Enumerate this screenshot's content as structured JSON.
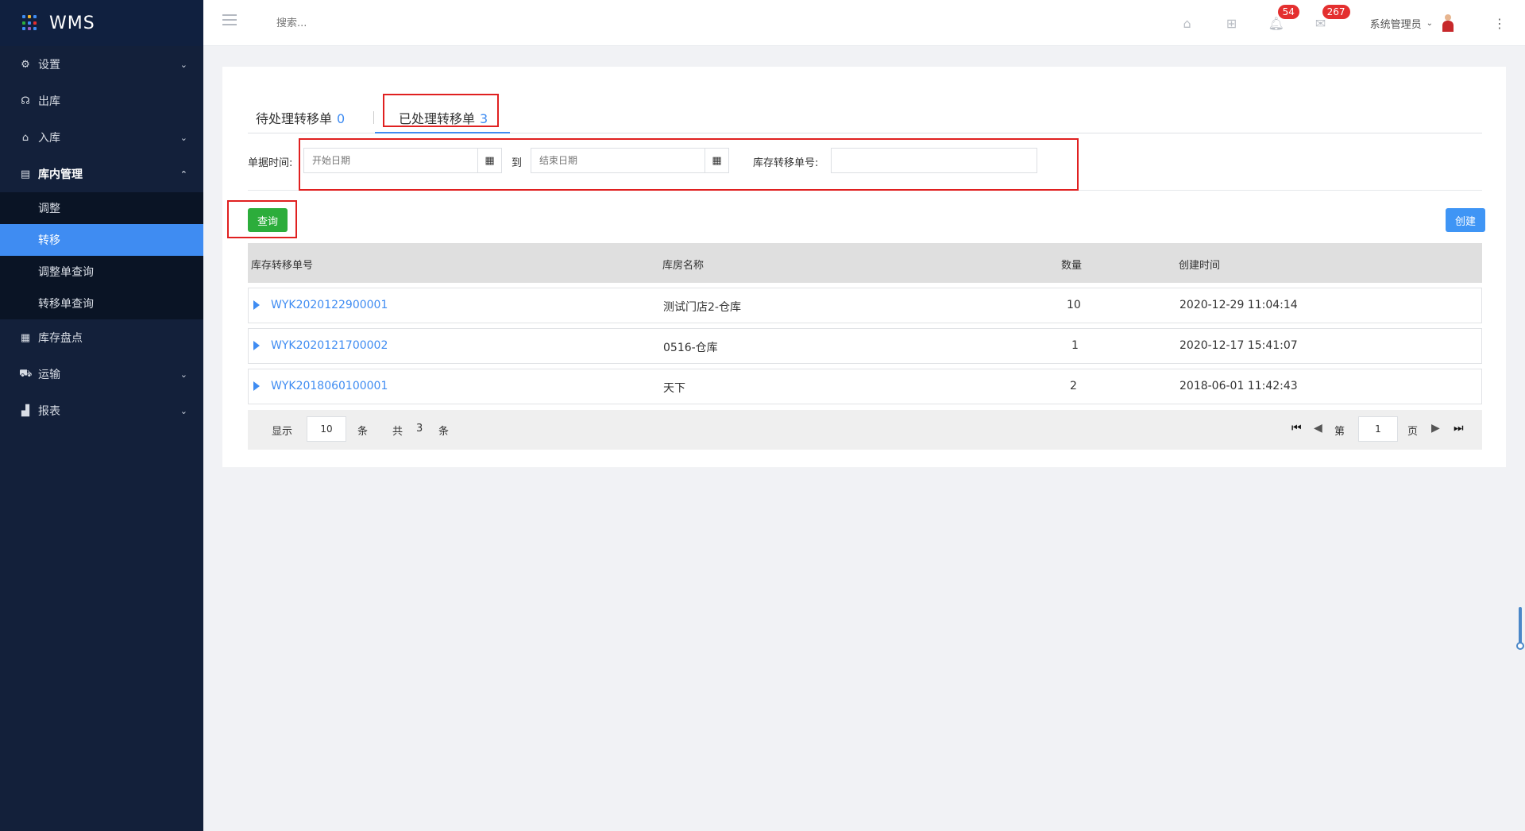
{
  "app": {
    "title": "WMS",
    "brand_dot_colors": [
      "#3f8cf2",
      "#f0b429",
      "#3f8cf2",
      "#2cad3b",
      "#3f8cf2",
      "#e42f2f",
      "#3f8cf2",
      "#9b59b6",
      "#3f8cf2"
    ]
  },
  "sidebar": {
    "items": [
      {
        "label": "设置",
        "icon": "gear-icon",
        "has_chevron": true
      },
      {
        "label": "出库",
        "icon": "headset-icon",
        "has_chevron": false
      },
      {
        "label": "入库",
        "icon": "home-icon",
        "has_chevron": true
      },
      {
        "label": "库内管理",
        "icon": "warehouse-icon",
        "has_chevron": true,
        "expanded": true
      },
      {
        "label": "库存盘点",
        "icon": "clipboard-icon",
        "has_chevron": false
      },
      {
        "label": "运输",
        "icon": "truck-icon",
        "has_chevron": true
      },
      {
        "label": "报表",
        "icon": "bar-chart-icon",
        "has_chevron": true
      }
    ],
    "subitems": [
      {
        "label": "调整"
      },
      {
        "label": "转移",
        "selected": true
      },
      {
        "label": "调整单查询"
      },
      {
        "label": "转移单查询"
      }
    ]
  },
  "topbar": {
    "search_placeholder": "搜索...",
    "notifications_badge": "54",
    "messages_badge": "267",
    "user_name": "系统管理员"
  },
  "tabs": [
    {
      "label": "待处理转移单",
      "count": "0"
    },
    {
      "label": "已处理转移单",
      "count": "3",
      "active": true
    }
  ],
  "filters": {
    "date_label": "单据时间:",
    "start_placeholder": "开始日期",
    "to_label": "到",
    "end_placeholder": "结束日期",
    "order_no_label": "库存转移单号:"
  },
  "buttons": {
    "query": "查询",
    "create": "创建"
  },
  "table": {
    "headers": [
      "库存转移单号",
      "库房名称",
      "数量",
      "创建时间"
    ],
    "rows": [
      {
        "order_no": "WYK2020122900001",
        "warehouse": "测试门店2-仓库",
        "qty": "10",
        "created": "2020-12-29 11:04:14"
      },
      {
        "order_no": "WYK2020121700002",
        "warehouse": "0516-仓库",
        "qty": "1",
        "created": "2020-12-17 15:41:07"
      },
      {
        "order_no": "WYK2018060100001",
        "warehouse": "天下",
        "qty": "2",
        "created": "2018-06-01 11:42:43"
      }
    ]
  },
  "pager": {
    "show_label": "显示",
    "page_size": "10",
    "per_unit": "条",
    "total_label": "共",
    "total": "3",
    "total_unit": "条",
    "page_label": "第",
    "page": "1",
    "page_unit": "页"
  }
}
